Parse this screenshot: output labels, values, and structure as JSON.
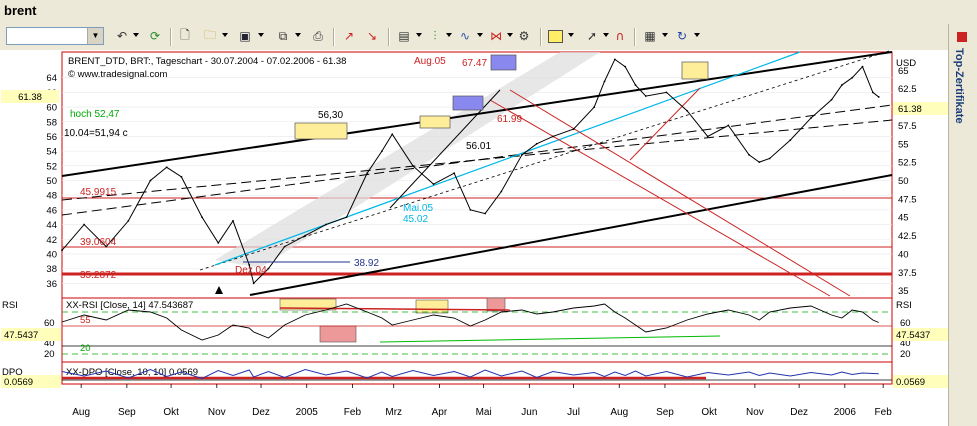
{
  "window": {
    "title": "brent"
  },
  "toolbar": {
    "combo_value": "",
    "icons": [
      "undo-arrow-icon",
      "refresh-icon",
      "new-document-icon",
      "open-folder-icon",
      "save-disk-icon",
      "copy-icon",
      "print-icon",
      "chart-arrow-icon",
      "chart-arrow-2-icon",
      "indicator-icon",
      "candles-icon",
      "wave-icon",
      "fibonacci-icon",
      "settings-icon",
      "rectangle-color-icon",
      "pointer-icon",
      "magnet-icon",
      "properties-icon",
      "reload-icon"
    ]
  },
  "side_panel": {
    "label": "Top-Zertifikate"
  },
  "colors": {
    "price": "#000000",
    "red": "#cc0000",
    "cyan": "#00b8e8",
    "yellow": "#ffee99",
    "blue": "#8888ee",
    "green": "#00bb00"
  },
  "chart_data": [
    {
      "type": "line",
      "title": "BRENT_DTD, BRT:, Tageschart - 30.07.2004 - 07.02.2006 - 61.38",
      "source": "© www.tradesignal.com",
      "currency": "USD",
      "last_value_left": "61.38",
      "last_value_right": "61.38",
      "x_ticks": [
        "Aug",
        "Sep",
        "Okt",
        "Nov",
        "Dez",
        "2005",
        "Feb",
        "Mrz",
        "Apr",
        "Mai",
        "Jun",
        "Jul",
        "Aug",
        "Sep",
        "Okt",
        "Nov",
        "Dez",
        "2006",
        "Feb"
      ],
      "left_ticks": [
        64,
        62,
        60,
        58,
        56,
        54,
        52,
        50,
        48,
        46,
        44,
        42,
        40,
        38,
        36
      ],
      "right_ticks": [
        "65",
        "62.5",
        "60",
        "57.5",
        "55",
        "52.5",
        "50",
        "47.5",
        "45",
        "42.5",
        "40",
        "37.5",
        "35"
      ],
      "ylim": [
        34,
        67.5
      ],
      "x": [
        "2004-08-02",
        "2004-08-17",
        "2004-09-01",
        "2004-09-16",
        "2004-10-01",
        "2004-10-12",
        "2004-10-22",
        "2004-11-05",
        "2004-11-16",
        "2004-11-26",
        "2004-12-07",
        "2004-12-10",
        "2004-12-20",
        "2004-12-31",
        "2005-01-14",
        "2005-01-28",
        "2005-02-11",
        "2005-02-25",
        "2005-03-07",
        "2005-03-14",
        "2005-03-28",
        "2005-04-11",
        "2005-04-25",
        "2005-05-06",
        "2005-05-16",
        "2005-05-27",
        "2005-06-10",
        "2005-06-20",
        "2005-07-01",
        "2005-07-15",
        "2005-07-29",
        "2005-08-05",
        "2005-08-12",
        "2005-08-19",
        "2005-08-26",
        "2005-09-02",
        "2005-09-16",
        "2005-09-30",
        "2005-10-14",
        "2005-10-28",
        "2005-11-11",
        "2005-11-18",
        "2005-11-25",
        "2005-12-09",
        "2005-12-23",
        "2006-01-06",
        "2006-01-13",
        "2006-01-20",
        "2006-01-27",
        "2006-02-03",
        "2006-02-07"
      ],
      "y": [
        40.5,
        44.0,
        41.0,
        44.5,
        50.0,
        51.8,
        50.5,
        45.0,
        41.5,
        44.5,
        38.5,
        36.0,
        38.0,
        41.0,
        42.5,
        44.0,
        45.0,
        51.0,
        54.0,
        56.3,
        52.0,
        49.5,
        51.0,
        46.0,
        45.5,
        48.5,
        53.5,
        55.0,
        56.0,
        57.0,
        60.0,
        63.5,
        66.5,
        65.5,
        63.0,
        61.5,
        62.0,
        59.5,
        56.0,
        57.5,
        53.5,
        52.5,
        53.0,
        55.5,
        58.5,
        61.0,
        63.0,
        64.0,
        65.5,
        62.0,
        61.38
      ],
      "annotations": [
        "hoch 52,47",
        "10.04=51,94 c",
        "56,30",
        "56.01",
        "Aug.05",
        "67.47",
        "61.99",
        "Mai.05",
        "45.02",
        "Dez.04",
        "38.92",
        "45.9915",
        "39.0604",
        "35.2872"
      ]
    },
    {
      "type": "line",
      "title": "RSI",
      "label": "XX-RSI [Close, 14] 47.543687",
      "value": "47.5437",
      "right_label": "RSI",
      "left_ticks": [
        "60",
        "40",
        "20"
      ],
      "right_ticks": [
        "60",
        "40",
        "20"
      ],
      "levels": [
        {
          "value": 55,
          "label": "55"
        },
        {
          "value": 20,
          "label": "20"
        }
      ],
      "ylim": [
        10,
        70
      ],
      "y": [
        48,
        55,
        50,
        60,
        58,
        52,
        40,
        30,
        35,
        45,
        42,
        38,
        32,
        45,
        55,
        60,
        66,
        58,
        52,
        45,
        50,
        55,
        52,
        44,
        50,
        58,
        60,
        56,
        58,
        62,
        64,
        66,
        58,
        52,
        45,
        38,
        42,
        50,
        56,
        60,
        55,
        50,
        58,
        62,
        64,
        55,
        52,
        60,
        58,
        50,
        47.5
      ]
    },
    {
      "type": "line",
      "title": "DPO",
      "label": "XX-DPO [Close, 10, 10] 0.0569",
      "value": "0.0569",
      "ylim": [
        -2,
        2
      ],
      "y": [
        0.5,
        -0.4,
        0.6,
        -0.8,
        0.9,
        -0.5,
        0.4,
        -0.9,
        0.7,
        -0.3,
        0.8,
        -0.6,
        0.5,
        -0.7,
        0.9,
        -0.2,
        0.6,
        -0.8,
        0.4,
        -0.5,
        0.7,
        -0.3,
        0.5,
        -0.6,
        0.8,
        -0.4,
        0.6,
        -0.7,
        0.5,
        -0.2,
        0.3,
        -0.5,
        0.4,
        -0.3,
        0.6,
        -0.4,
        0.5,
        -0.6,
        0.3,
        -0.2,
        0.4,
        -0.3,
        0.2,
        -0.4,
        0.3,
        -0.2,
        0.4,
        -0.1,
        0.2,
        0.1,
        0.0569
      ]
    }
  ]
}
